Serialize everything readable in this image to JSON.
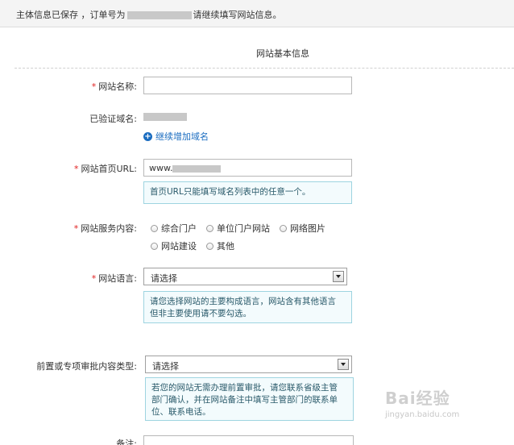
{
  "notice": {
    "prefix": "主体信息已保存 ，订单号为",
    "suffix": "请继续填写网站信息。"
  },
  "section_title": "网站基本信息",
  "fields": {
    "site_name": {
      "required": "*",
      "label": "网站名称:",
      "value": ""
    },
    "verified_domain": {
      "label": "已验证域名:",
      "add_link": "继续增加域名"
    },
    "homepage": {
      "required": "*",
      "label": "网站首页URL:",
      "value_prefix": "www.",
      "hint": "首页URL只能填写域名列表中的任意一个。"
    },
    "service": {
      "required": "*",
      "label": "网站服务内容:",
      "options": [
        "综合门户",
        "单位门户网站",
        "网络图片",
        "网站建设",
        "其他"
      ]
    },
    "language": {
      "required": "*",
      "label": "网站语言:",
      "selected": "请选择",
      "hint_line1": "请您选择网站的主要构成语言，网站含有其他语言",
      "hint_line2": "但非主要使用请不要勾选。"
    },
    "approval": {
      "label": "前置或专项审批内容类型:",
      "selected": "请选择",
      "hint_line1": "若您的网站无需办理前置审批，请您联系省级主管",
      "hint_line2": "部门确认，并在网站备注中填写主管部门的联系单",
      "hint_line3": "位、联系电话。"
    },
    "remark": {
      "label": "备注:"
    }
  },
  "watermark": {
    "main": "Bai经验",
    "sub": "jingyan.baidu.com"
  },
  "colors": {
    "required": "#e02020",
    "link": "#1a6cc0",
    "hint_border": "#9ed4e0",
    "hint_bg": "#f3fbfd"
  }
}
